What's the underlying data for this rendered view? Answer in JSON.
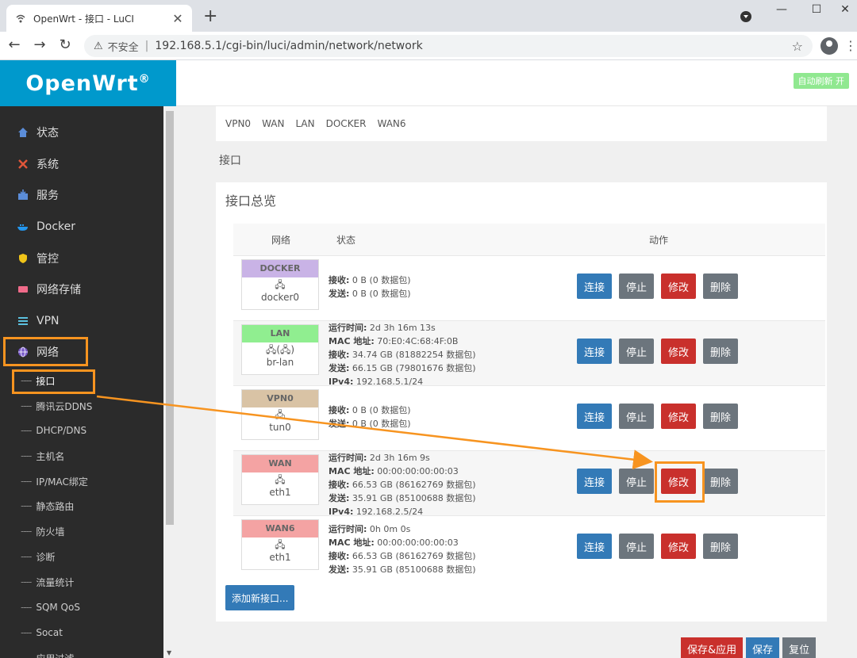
{
  "browser": {
    "tab_title": "OpenWrt - 接口 - LuCI",
    "close_glyph": "✕",
    "new_tab_glyph": "+",
    "insecure_label": "不安全",
    "separator": "|",
    "url": "192.168.5.1/cgi-bin/luci/admin/network/network"
  },
  "header": {
    "brand": "OpenWrt",
    "brand_mark": "®",
    "auto_refresh": "自动刷新 开"
  },
  "sidebar": {
    "items": [
      {
        "label": "状态",
        "icon": "home-icon"
      },
      {
        "label": "系统",
        "icon": "tools-icon"
      },
      {
        "label": "服务",
        "icon": "inbox-icon"
      },
      {
        "label": "Docker",
        "icon": "docker-icon"
      },
      {
        "label": "管控",
        "icon": "shield-icon"
      },
      {
        "label": "网络存储",
        "icon": "drive-icon"
      },
      {
        "label": "VPN",
        "icon": "list-icon"
      },
      {
        "label": "网络",
        "icon": "globe-icon"
      }
    ],
    "submenu": [
      "接口",
      "腾讯云DDNS",
      "DHCP/DNS",
      "主机名",
      "IP/MAC绑定",
      "静态路由",
      "防火墙",
      "诊断",
      "流量统计",
      "SQM QoS",
      "Socat",
      "应用过滤"
    ]
  },
  "subtabs": [
    "VPN0",
    "WAN",
    "LAN",
    "DOCKER",
    "WAN6"
  ],
  "breadcrumb": "接口",
  "panel_title": "接口总览",
  "table": {
    "headers": {
      "network": "网络",
      "status": "状态",
      "actions": "动作"
    },
    "rows": [
      {
        "name": "DOCKER",
        "color": "#c9b3e6",
        "icon": "🖧",
        "device": "docker0",
        "lines": [
          [
            "接收:",
            "0 B (0 数据包)"
          ],
          [
            "发送:",
            "0 B (0 数据包)"
          ]
        ]
      },
      {
        "name": "LAN",
        "color": "#90ee90",
        "icon": "🖧(🖧)",
        "device": "br-lan",
        "lines": [
          [
            "运行时间:",
            "2d 3h 16m 13s"
          ],
          [
            "MAC 地址:",
            "70:E0:4C:68:4F:0B"
          ],
          [
            "接收:",
            "34.74 GB (81882254 数据包)"
          ],
          [
            "发送:",
            "66.15 GB (79801676 数据包)"
          ],
          [
            "IPv4:",
            "192.168.5.1/24"
          ]
        ]
      },
      {
        "name": "VPN0",
        "color": "#d9c3a5",
        "icon": "🖧",
        "device": "tun0",
        "lines": [
          [
            "接收:",
            "0 B (0 数据包)"
          ],
          [
            "发送:",
            "0 B (0 数据包)"
          ]
        ]
      },
      {
        "name": "WAN",
        "color": "#f4a3a3",
        "icon": "🖧",
        "device": "eth1",
        "lines": [
          [
            "运行时间:",
            "2d 3h 16m 9s"
          ],
          [
            "MAC 地址:",
            "00:00:00:00:00:03"
          ],
          [
            "接收:",
            "66.53 GB (86162769 数据包)"
          ],
          [
            "发送:",
            "35.91 GB (85100688 数据包)"
          ],
          [
            "IPv4:",
            "192.168.2.5/24"
          ]
        ]
      },
      {
        "name": "WAN6",
        "color": "#f4a3a3",
        "icon": "🖧",
        "device": "eth1",
        "lines": [
          [
            "运行时间:",
            "0h 0m 0s"
          ],
          [
            "MAC 地址:",
            "00:00:00:00:00:03"
          ],
          [
            "接收:",
            "66.53 GB (86162769 数据包)"
          ],
          [
            "发送:",
            "35.91 GB (85100688 数据包)"
          ]
        ]
      }
    ],
    "buttons": {
      "connect": "连接",
      "stop": "停止",
      "edit": "修改",
      "delete": "删除"
    }
  },
  "add_interface": "添加新接口...",
  "footer": {
    "save_apply": "保存&应用",
    "save": "保存",
    "reset": "复位"
  },
  "colors": {
    "brand": "#0099cc",
    "highlight": "#f79420",
    "edit": "#c9302c",
    "connect": "#337ab7"
  }
}
